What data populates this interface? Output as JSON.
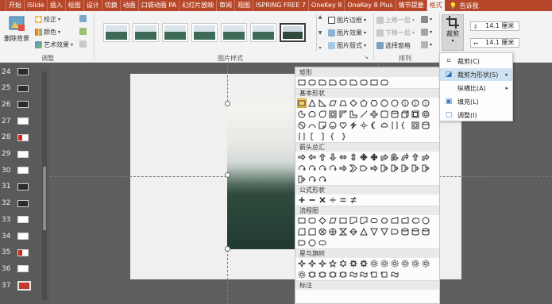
{
  "tabs": [
    "开始",
    "iSlide",
    "插入",
    "绘图",
    "设计",
    "切换",
    "动画",
    "口袋动画 PA",
    "幻灯片放映",
    "审阅",
    "视图",
    "ISPRING FREE 7",
    "OneKey 8",
    "OneKey 8 Plus",
    "情节提要",
    "格式"
  ],
  "tell_me": "告诉我",
  "ribbon": {
    "remove_bg": "删除背景",
    "correct": "校正",
    "color": "颜色",
    "art_effects": "艺术效果",
    "adjust_label": "调整",
    "picture_border": "图片边框",
    "picture_effects": "图片效果",
    "picture_layout": "图片版式",
    "styles_label": "图片样式",
    "bring_forward": "上移一层",
    "send_backward": "下移一层",
    "selection_pane": "选择窗格",
    "arrange_label": "排列",
    "crop": "裁剪",
    "height": "14.1 厘米",
    "width": "14.1 厘米"
  },
  "slides": [
    {
      "num": "24",
      "style": "dark"
    },
    {
      "num": "25",
      "style": "dark"
    },
    {
      "num": "26",
      "style": "dark"
    },
    {
      "num": "27",
      "style": "light"
    },
    {
      "num": "28",
      "style": "red"
    },
    {
      "num": "29",
      "style": "light"
    },
    {
      "num": "30",
      "style": "light"
    },
    {
      "num": "31",
      "style": "dark"
    },
    {
      "num": "32",
      "style": "dark"
    },
    {
      "num": "33",
      "style": "light"
    },
    {
      "num": "34",
      "style": "light"
    },
    {
      "num": "35",
      "style": "red"
    },
    {
      "num": "36",
      "style": "light"
    },
    {
      "num": "37",
      "style": "bigred"
    }
  ],
  "shapes_menu": {
    "rect": "矩形",
    "basic": "基本形状",
    "arrows": "箭头总汇",
    "equation": "公式形状",
    "flowchart": "流程图",
    "stars": "星与旗帜",
    "callouts": "标注"
  },
  "crop_menu": {
    "crop": "裁剪(C)",
    "crop_to_shape": "裁剪为形状(S)",
    "aspect_ratio": "纵横比(A)",
    "fill": "填充(L)",
    "fit": "调整(I)"
  }
}
